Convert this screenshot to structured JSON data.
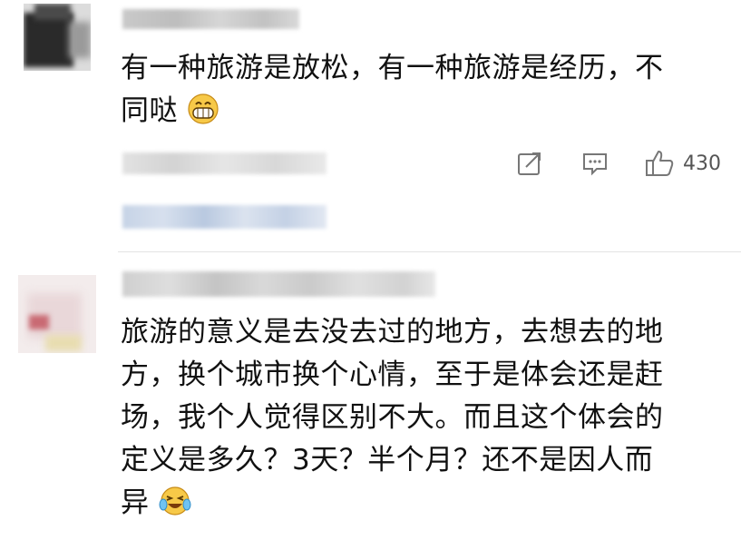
{
  "comments": [
    {
      "id": "comment-1",
      "text_line1": "有一种旅游是放松，有一种旅游是经历，不",
      "text_line2": "同哒",
      "emoji": "grinning-face-icon",
      "like_count": "430"
    },
    {
      "id": "comment-2",
      "text_lines": [
        "旅游的意义是去没去过的地方，去想去的地",
        "方，换个城市换个心情，至于是体会还是赶",
        "场，我个人觉得区别不大。而且这个体会的",
        "定义是多久？3天？半个月？还不是因人而",
        "异"
      ],
      "emoji": "laughing-crying-face-icon"
    }
  ],
  "icons": {
    "share": "share-icon",
    "comment": "comment-icon",
    "like": "thumbs-up-icon"
  },
  "colors": {
    "text": "#111111",
    "meta": "#666666",
    "divider": "#e3e3e3",
    "emoji_yellow": "#f7c948"
  }
}
